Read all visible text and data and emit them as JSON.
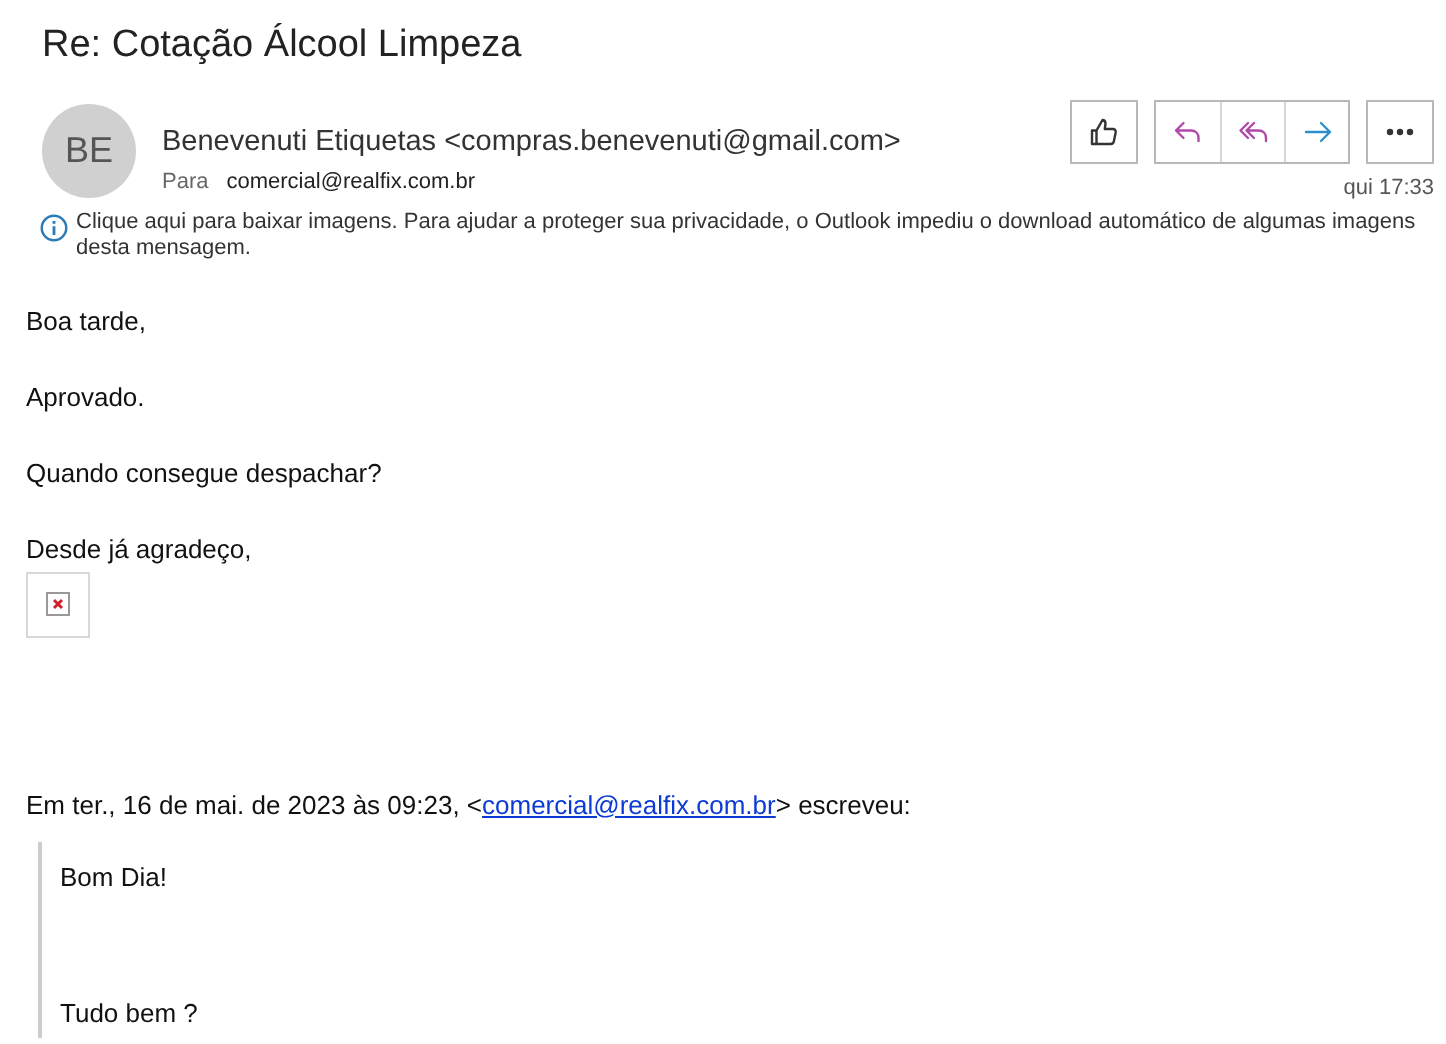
{
  "subject": "Re: Cotação Álcool Limpeza",
  "sender": {
    "initials": "BE",
    "display": "Benevenuti Etiquetas <compras.benevenuti@gmail.com>",
    "to_label": "Para",
    "to": "comercial@realfix.com.br",
    "time": "qui 17:33"
  },
  "actions": [
    {
      "kind": "like"
    },
    {
      "kind": "reply"
    },
    {
      "kind": "reply_all"
    },
    {
      "kind": "forward"
    },
    {
      "kind": "more"
    }
  ],
  "info_bar": "Clique aqui para baixar imagens. Para ajudar a proteger sua privacidade, o Outlook impediu o download automático de algumas imagens desta mensagem.",
  "body": [
    "Boa tarde,",
    "Aprovado.",
    "Quando consegue despachar?",
    "Desde já agradeço,"
  ],
  "attribution": {
    "prefix": "Em ter., 16 de mai. de 2023 às 09:23, <",
    "link": "comercial@realfix.com.br",
    "suffix": "> escreveu:"
  },
  "quote": [
    "Bom Dia!",
    "Tudo bem ?"
  ]
}
